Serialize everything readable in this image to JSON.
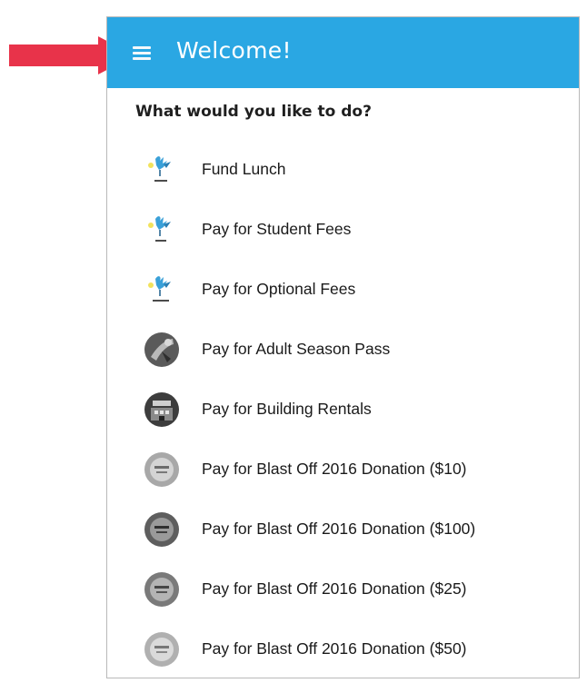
{
  "header": {
    "menu_icon": "hamburger-menu-icon",
    "title": "Welcome!"
  },
  "prompt": "What would you like to do?",
  "menu": {
    "items": [
      {
        "label": "Fund Lunch",
        "icon": "school-logo-icon"
      },
      {
        "label": "Pay for Student Fees",
        "icon": "school-logo-icon"
      },
      {
        "label": "Pay for Optional Fees",
        "icon": "school-logo-icon"
      },
      {
        "label": "Pay for Adult Season Pass",
        "icon": "photo-avatar"
      },
      {
        "label": "Pay for Building Rentals",
        "icon": "photo-avatar"
      },
      {
        "label": "Pay for Blast Off 2016 Donation ($10)",
        "icon": "photo-avatar"
      },
      {
        "label": "Pay for Blast Off 2016 Donation ($100)",
        "icon": "photo-avatar"
      },
      {
        "label": "Pay for Blast Off 2016 Donation ($25)",
        "icon": "photo-avatar"
      },
      {
        "label": "Pay for Blast Off 2016 Donation ($50)",
        "icon": "photo-avatar"
      }
    ]
  },
  "colors": {
    "header_bg": "#2aa7e3",
    "arrow": "#e8334a",
    "text": "#1a1a1a"
  }
}
